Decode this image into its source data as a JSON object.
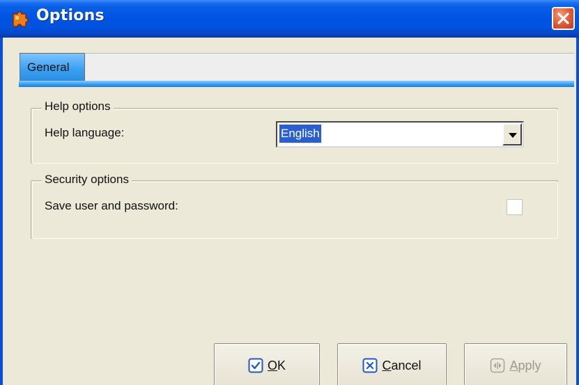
{
  "window": {
    "title": "Options",
    "app_icon": "puzzle-icon",
    "close_icon": "close-icon"
  },
  "tabs": [
    {
      "label": "General",
      "selected": true
    }
  ],
  "help_options": {
    "group_title": "Help options",
    "language_label": "Help language:",
    "language_value": "English"
  },
  "security_options": {
    "group_title": "Security options",
    "save_label": "Save user and password:",
    "save_checked": false
  },
  "buttons": {
    "ok": {
      "mnemonic": "O",
      "rest": "K",
      "icon": "check-icon"
    },
    "cancel": {
      "mnemonic": "C",
      "rest": "ancel",
      "icon": "x-icon"
    },
    "apply": {
      "mnemonic": "A",
      "rest": "pply",
      "icon": "apply-icon",
      "disabled": true
    }
  },
  "colors": {
    "title_bar": "#0054e3",
    "tab_blue": "#3aa1f3",
    "selection": "#2a5fd4",
    "face": "#ece9d8"
  }
}
